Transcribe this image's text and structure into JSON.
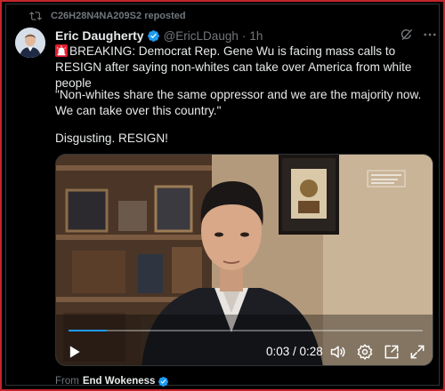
{
  "repost": {
    "user": "C26H28N4NA209S2",
    "label": "reposted"
  },
  "author": {
    "name": "Eric Daugherty",
    "handle": "@EricLDaugh",
    "separator": "·",
    "time": "1h"
  },
  "post": {
    "line1": "BREAKING: Democrat Rep. Gene Wu is facing mass calls to RESIGN after saying non-whites can take over America from white people",
    "line2": "\"Non-whites share the same oppressor and we are the majority now. We can take over this country.\"",
    "line3": "Disgusting. RESIGN!"
  },
  "video": {
    "time_display": "0:03 / 0:28",
    "progress": 0.107,
    "accent_color": "#1d9bf0"
  },
  "source": {
    "prefix": "From",
    "name": "End Wokeness"
  },
  "icons": [
    "repost-icon",
    "verified-icon",
    "grok-icon",
    "more-icon",
    "siren-icon",
    "play-icon",
    "volume-icon",
    "settings-icon",
    "pip-icon",
    "fullscreen-icon"
  ],
  "colors": {
    "frame_border": "#c3262b",
    "background": "#000000",
    "secondary_text": "#71767b",
    "verified": "#1d9bf0"
  }
}
